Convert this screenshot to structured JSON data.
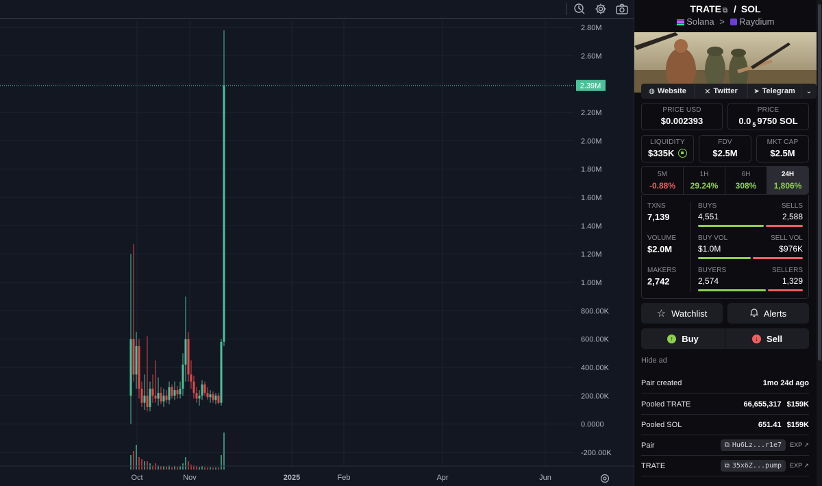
{
  "toolbar": {
    "icons": [
      "indicators-icon",
      "settings-icon",
      "camera-icon"
    ]
  },
  "chart_data": {
    "type": "candlestick",
    "ylabel": "",
    "y_ticks": [
      "2.80M",
      "2.60M",
      "2.40M",
      "2.20M",
      "2.00M",
      "1.80M",
      "1.60M",
      "1.40M",
      "1.20M",
      "1.00M",
      "800.00K",
      "600.00K",
      "400.00K",
      "200.00K",
      "0.0000",
      "-200.00K"
    ],
    "y_tick_values": [
      2800000,
      2600000,
      2400000,
      2200000,
      2000000,
      1800000,
      1600000,
      1400000,
      1200000,
      1000000,
      800000,
      600000,
      400000,
      200000,
      0,
      -200000
    ],
    "x_ticks": [
      {
        "label": "Oct",
        "bold": false
      },
      {
        "label": "Nov",
        "bold": false
      },
      {
        "label": "2025",
        "bold": true
      },
      {
        "label": "Feb",
        "bold": false
      },
      {
        "label": "Apr",
        "bold": false
      },
      {
        "label": "Jun",
        "bold": false
      }
    ],
    "ylim": [
      -200000,
      2800000
    ],
    "current_price_label": "2.39M",
    "current_price": 2390000,
    "up_color": "#4fbf9a",
    "down_color": "#e04a4a",
    "candles": [
      {
        "o": 200000,
        "h": 1200000,
        "l": 0,
        "c": 600000
      },
      {
        "o": 600000,
        "h": 1270000,
        "l": 300000,
        "c": 350000
      },
      {
        "o": 350000,
        "h": 650000,
        "l": 250000,
        "c": 550000
      },
      {
        "o": 550000,
        "h": 600000,
        "l": 180000,
        "c": 250000
      },
      {
        "o": 250000,
        "h": 300000,
        "l": 120000,
        "c": 150000
      },
      {
        "o": 150000,
        "h": 350000,
        "l": 100000,
        "c": 200000
      },
      {
        "o": 200000,
        "h": 620000,
        "l": 90000,
        "c": 120000
      },
      {
        "o": 120000,
        "h": 300000,
        "l": 90000,
        "c": 250000
      },
      {
        "o": 250000,
        "h": 350000,
        "l": 150000,
        "c": 200000
      },
      {
        "o": 200000,
        "h": 450000,
        "l": 150000,
        "c": 180000
      },
      {
        "o": 180000,
        "h": 330000,
        "l": 130000,
        "c": 220000
      },
      {
        "o": 220000,
        "h": 260000,
        "l": 140000,
        "c": 160000
      },
      {
        "o": 160000,
        "h": 250000,
        "l": 120000,
        "c": 200000
      },
      {
        "o": 200000,
        "h": 240000,
        "l": 150000,
        "c": 170000
      },
      {
        "o": 170000,
        "h": 300000,
        "l": 140000,
        "c": 260000
      },
      {
        "o": 260000,
        "h": 280000,
        "l": 180000,
        "c": 200000
      },
      {
        "o": 200000,
        "h": 300000,
        "l": 170000,
        "c": 240000
      },
      {
        "o": 240000,
        "h": 270000,
        "l": 180000,
        "c": 210000
      },
      {
        "o": 210000,
        "h": 300000,
        "l": 180000,
        "c": 250000
      },
      {
        "o": 250000,
        "h": 500000,
        "l": 200000,
        "c": 420000
      },
      {
        "o": 420000,
        "h": 900000,
        "l": 300000,
        "c": 600000
      },
      {
        "o": 600000,
        "h": 650000,
        "l": 300000,
        "c": 350000
      },
      {
        "o": 350000,
        "h": 450000,
        "l": 250000,
        "c": 300000
      },
      {
        "o": 300000,
        "h": 340000,
        "l": 180000,
        "c": 220000
      },
      {
        "o": 220000,
        "h": 260000,
        "l": 150000,
        "c": 180000
      },
      {
        "o": 180000,
        "h": 240000,
        "l": 130000,
        "c": 200000
      },
      {
        "o": 200000,
        "h": 310000,
        "l": 170000,
        "c": 280000
      },
      {
        "o": 280000,
        "h": 300000,
        "l": 200000,
        "c": 220000
      },
      {
        "o": 220000,
        "h": 260000,
        "l": 170000,
        "c": 190000
      },
      {
        "o": 190000,
        "h": 240000,
        "l": 150000,
        "c": 210000
      },
      {
        "o": 210000,
        "h": 230000,
        "l": 150000,
        "c": 170000
      },
      {
        "o": 170000,
        "h": 220000,
        "l": 140000,
        "c": 200000
      },
      {
        "o": 200000,
        "h": 220000,
        "l": 140000,
        "c": 150000
      },
      {
        "o": 150000,
        "h": 600000,
        "l": 130000,
        "c": 580000
      },
      {
        "o": 580000,
        "h": 2780000,
        "l": 550000,
        "c": 2390000
      }
    ],
    "volume_bars": [
      0.35,
      0.45,
      0.6,
      0.3,
      0.25,
      0.2,
      0.2,
      0.15,
      0.1,
      0.15,
      0.1,
      0.08,
      0.08,
      0.07,
      0.1,
      0.06,
      0.08,
      0.06,
      0.08,
      0.15,
      0.3,
      0.2,
      0.12,
      0.1,
      0.08,
      0.06,
      0.08,
      0.06,
      0.05,
      0.06,
      0.05,
      0.05,
      0.05,
      0.35,
      0.9
    ]
  },
  "header": {
    "base": "TRATE",
    "separator": "/",
    "quote": "SOL",
    "chain": "Solana",
    "crumb_sep": ">",
    "dex": "Raydium"
  },
  "links": {
    "website": "Website",
    "twitter": "Twitter",
    "telegram": "Telegram"
  },
  "stats": {
    "price_usd_label": "PRICE USD",
    "price_usd": "$0.002393",
    "price_label": "PRICE",
    "price_prefix": "0.0",
    "price_sub": "5",
    "price_rest": "9750 SOL",
    "liquidity_label": "LIQUIDITY",
    "liquidity": "$335K",
    "fdv_label": "FDV",
    "fdv": "$2.5M",
    "mktcap_label": "MKT CAP",
    "mktcap": "$2.5M"
  },
  "timeframes": [
    {
      "label": "5M",
      "value": "-0.88%",
      "color": "#ef5f5f"
    },
    {
      "label": "1H",
      "value": "29.24%",
      "color": "#8fd14f"
    },
    {
      "label": "6H",
      "value": "308%",
      "color": "#8fd14f"
    },
    {
      "label": "24H",
      "value": "1,806%",
      "color": "#8fd14f"
    }
  ],
  "metrics": {
    "txns_label": "TXNS",
    "txns": "7,139",
    "buys_label": "BUYS",
    "buys": "4,551",
    "sells_label": "SELLS",
    "sells": "2,588",
    "volume_label": "VOLUME",
    "volume": "$2.0M",
    "buyvol_label": "BUY VOL",
    "buyvol": "$1.0M",
    "sellvol_label": "SELL VOL",
    "sellvol": "$976K",
    "makers_label": "MAKERS",
    "makers": "2,742",
    "buyers_label": "BUYERS",
    "buyers": "2,574",
    "sellers_label": "SELLERS",
    "sellers": "1,329",
    "buys_ratio": 0.637,
    "buyvol_ratio": 0.51,
    "buyers_ratio": 0.66
  },
  "actions": {
    "watchlist": "Watchlist",
    "alerts": "Alerts",
    "buy": "Buy",
    "sell": "Sell"
  },
  "hide_ad": "Hide ad",
  "info": {
    "pair_created_label": "Pair created",
    "pair_created": "1mo 24d ago",
    "pooled_base_label": "Pooled TRATE",
    "pooled_base_amt": "66,655,317",
    "pooled_base_usd": "$159K",
    "pooled_quote_label": "Pooled SOL",
    "pooled_quote_amt": "651.41",
    "pooled_quote_usd": "$159K",
    "pair_label": "Pair",
    "pair_addr": "Hu6Lz...r1e7",
    "token_label": "TRATE",
    "token_addr": "35x6Z...pump",
    "exp": "EXP"
  }
}
